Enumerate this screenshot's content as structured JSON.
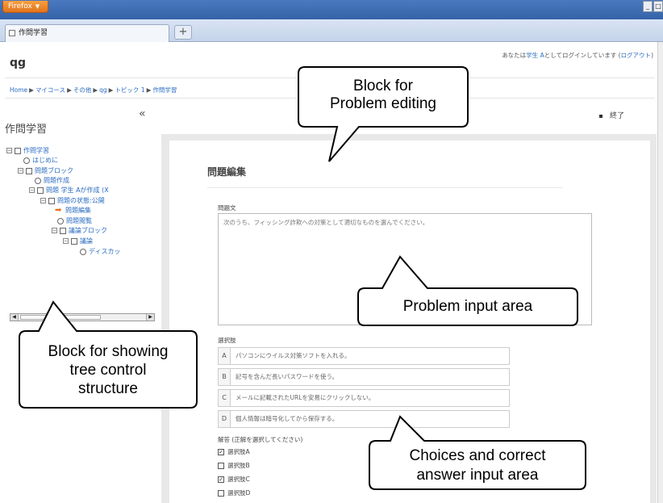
{
  "browser": {
    "menu_button": "Firefox",
    "window_controls": [
      "_",
      "□"
    ],
    "tab_title": "作問学習",
    "new_tab": "+"
  },
  "page": {
    "site_short": "qg",
    "login": {
      "prefix": "あなたは",
      "user": "学生 A",
      "middle": "としてログインしています (",
      "logout": "ログアウト",
      "suffix": ")"
    },
    "breadcrumb": [
      "Home",
      "マイコース",
      "その他",
      "qg",
      "トピック 1",
      "作問学習"
    ],
    "end_button": "終了"
  },
  "tree_block": {
    "title": "作問学習",
    "collapse": "«",
    "items": [
      {
        "label": "作問学習",
        "type": "folder",
        "expander": "⊟"
      },
      {
        "label": "はじめに",
        "type": "leaf"
      },
      {
        "label": "問題ブロック",
        "type": "folder",
        "expander": "⊟"
      },
      {
        "label": "問題作成",
        "type": "leaf"
      },
      {
        "label": "問題 学生 Aが作成 (X",
        "type": "folder",
        "expander": "⊟"
      },
      {
        "label": "問題の状態:公開",
        "type": "folder",
        "expander": "⊟"
      },
      {
        "label": "問題編集",
        "type": "current"
      },
      {
        "label": "問題閲覧",
        "type": "leaf"
      },
      {
        "label": "議論ブロック",
        "type": "folder",
        "expander": "⊟"
      },
      {
        "label": "議論",
        "type": "folder",
        "expander": "⊟"
      },
      {
        "label": "ディスカッ",
        "type": "leaf"
      }
    ],
    "scroll_left": "◀",
    "scroll_right": "▶"
  },
  "editor": {
    "heading": "問題編集",
    "question_label": "問題文",
    "question_text": "次のうち、フィッシング詐欺への対策として適切なものを選んでください。",
    "choices_label": "選択肢",
    "choices": [
      {
        "letter": "A",
        "text": "パソコンにウイルス対策ソフトを入れる。"
      },
      {
        "letter": "B",
        "text": "記号を含んだ長いパスワードを使う。"
      },
      {
        "letter": "C",
        "text": "メールに記載されたURLを安易にクリックしない。"
      },
      {
        "letter": "D",
        "text": "個人情報は暗号化してから保存する。"
      }
    ],
    "answer_label": "解答 (正解を選択してください)",
    "answers": [
      {
        "label": "選択肢A",
        "checked": true,
        "mark": "✓"
      },
      {
        "label": "選択肢B",
        "checked": false,
        "mark": ""
      },
      {
        "label": "選択肢C",
        "checked": true,
        "mark": "✓"
      },
      {
        "label": "選択肢D",
        "checked": false,
        "mark": ""
      }
    ]
  },
  "annotations": {
    "problem_editing": [
      "Block for",
      "Problem editing"
    ],
    "problem_input": "Problem input area",
    "tree_control": [
      "Block for showing",
      "tree control",
      "structure"
    ],
    "choices_answer": [
      "Choices and correct",
      "answer input area"
    ]
  }
}
